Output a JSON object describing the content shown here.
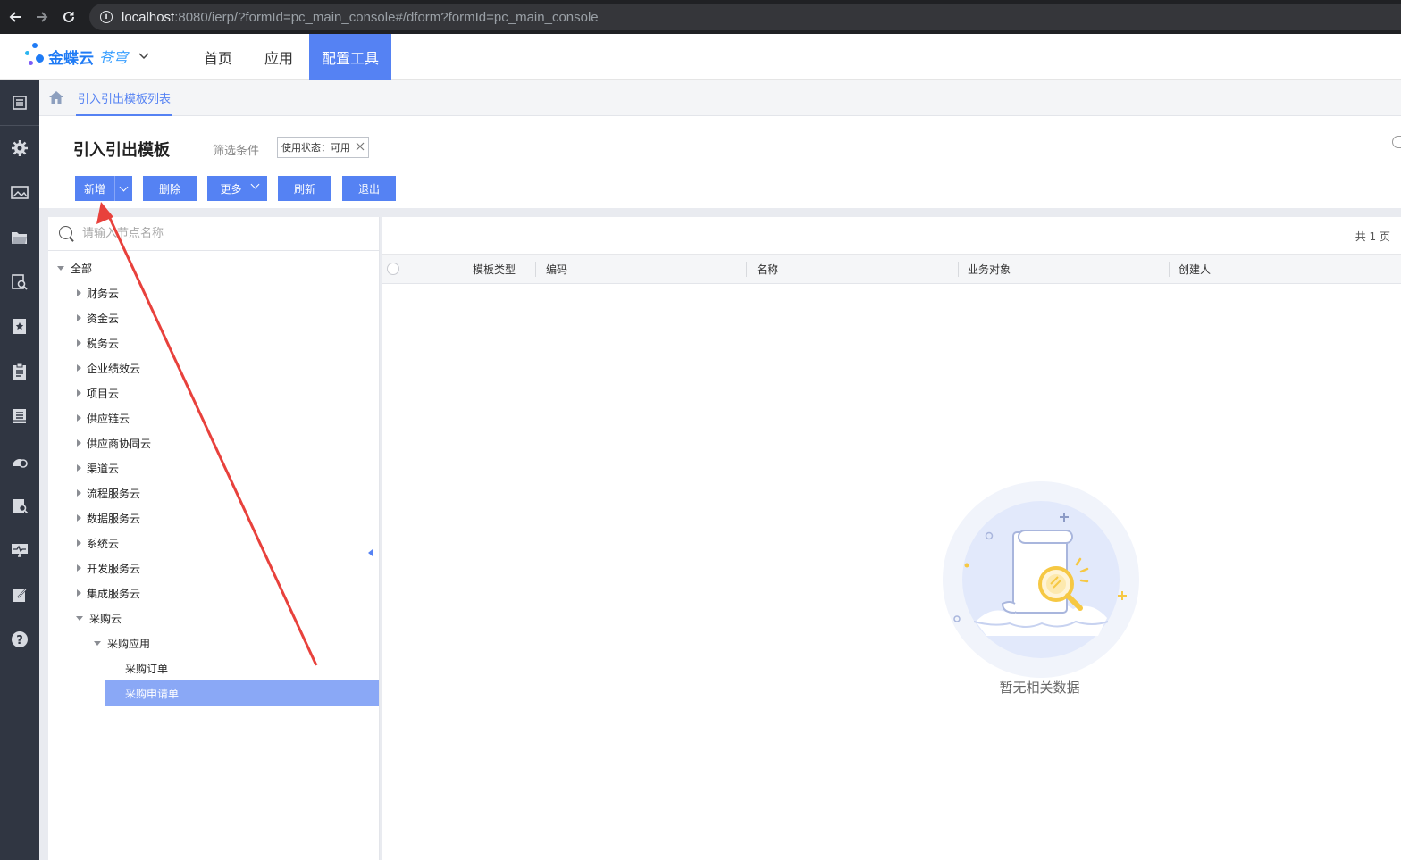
{
  "browser": {
    "url_host": "localhost",
    "url_rest": ":8080/ierp/?formId=pc_main_console#/dform?formId=pc_main_console"
  },
  "header": {
    "logo_main": "金蝶云",
    "logo_sub": "苍穹",
    "tabs": [
      {
        "label": "首页",
        "active": false
      },
      {
        "label": "应用",
        "active": false
      },
      {
        "label": "配置工具",
        "active": true
      }
    ]
  },
  "left_rail": {
    "icons": [
      "list-icon",
      "gear-icon",
      "image-icon",
      "folder-icon",
      "search-doc-icon",
      "star-book-icon",
      "clipboard-icon",
      "book-icon",
      "dashboard-icon",
      "calendar-search-icon",
      "monitor-icon",
      "edit-icon",
      "help-icon"
    ]
  },
  "breadcrumb": {
    "tab_label": "引入引出模板列表"
  },
  "toolbar": {
    "title": "引入引出模板",
    "filter_label": "筛选条件",
    "filter_chip": "使用状态：可用",
    "buttons": {
      "add": "新增",
      "delete": "删除",
      "more": "更多",
      "refresh": "刷新",
      "exit": "退出"
    }
  },
  "tree": {
    "search_placeholder": "请输入节点名称",
    "root": "全部",
    "nodes": [
      "财务云",
      "资金云",
      "税务云",
      "企业绩效云",
      "项目云",
      "供应链云",
      "供应商协同云",
      "渠道云",
      "流程服务云",
      "数据服务云",
      "系统云",
      "开发服务云",
      "集成服务云"
    ],
    "expanded_node": "采购云",
    "expanded_child": "采购应用",
    "leaves": [
      "采购订单",
      "采购申请单"
    ],
    "selected_leaf": "采购申请单"
  },
  "grid": {
    "page_count": "共 1 页",
    "columns": [
      "模板类型",
      "编码",
      "名称",
      "业务对象",
      "创建人"
    ],
    "empty_text": "暂无相关数据"
  },
  "colors": {
    "accent": "#5582f3",
    "rail_bg": "#303642",
    "selected_row": "#8aa8f6",
    "annotation_arrow": "#e8413c"
  }
}
